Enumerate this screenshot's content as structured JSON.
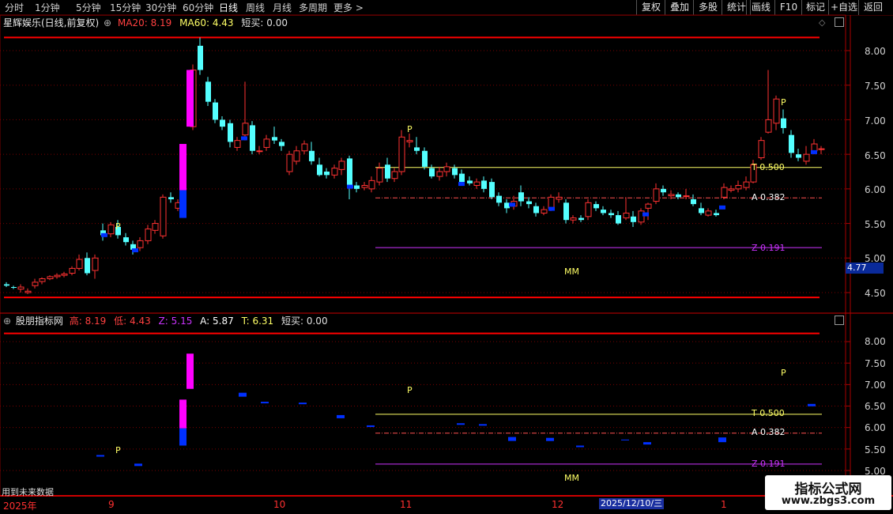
{
  "toolbar": {
    "items": [
      "分时",
      "1分钟",
      "5分钟",
      "15分钟",
      "30分钟",
      "60分钟",
      "日线",
      "周线",
      "月线",
      "多周期",
      "更多 >"
    ],
    "active_index": 6,
    "right_buttons": [
      "复权",
      "叠加",
      "多股",
      "统计",
      "画线",
      "F10",
      "标记",
      "+自选",
      "返回"
    ]
  },
  "main_panel": {
    "stock": "星辉娱乐(日线,前复权)",
    "ma20_label": "MA20: 8.19",
    "ma60_label": "MA60: 4.43",
    "short_buy_label": "短买: 0.00",
    "price_axis": [
      "8.00",
      "7.50",
      "7.00",
      "6.50",
      "6.00",
      "5.50",
      "5.00",
      "4.50"
    ],
    "current_price": "4.77",
    "fib_labels": {
      "t": "T 0.500",
      "a": "A 0.382",
      "z": "Z 0.191"
    },
    "mm_label": "MM",
    "p_marker": "P"
  },
  "sub_panel": {
    "name": "股朋指标网",
    "high_label": "高: 8.19",
    "low_label": "低: 4.43",
    "z_label": "Z: 5.15",
    "a_label": "A: 5.87",
    "t_label": "T: 6.31",
    "short_buy_label": "短买: 0.00",
    "price_axis": [
      "8.00",
      "7.50",
      "7.00",
      "6.50",
      "6.00",
      "5.50",
      "5.00"
    ],
    "future_data_note": "用到未来数据"
  },
  "time_axis": {
    "labels": [
      "2025年",
      "9",
      "10",
      "11",
      "12",
      "1"
    ],
    "cursor_date": "2025/12/10/三"
  },
  "watermark": {
    "title": "指标公式网",
    "url": "www.zbgs3.com"
  },
  "colors": {
    "up": "#ff3232",
    "down": "#54ffff",
    "blue": "#0030ff",
    "magenta": "#ff00ff",
    "yellow": "#ffff66",
    "red_line": "#ff0000",
    "purple": "#cc33ff",
    "grid": "#7a0000"
  }
}
